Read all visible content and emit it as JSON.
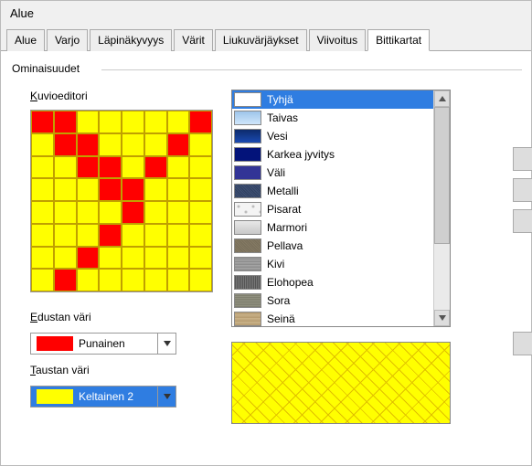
{
  "window": {
    "title": "Alue"
  },
  "tabs": [
    {
      "label": "Alue",
      "active": false
    },
    {
      "label": "Varjo",
      "active": false
    },
    {
      "label": "Läpinäkyvyys",
      "active": false
    },
    {
      "label": "Värit",
      "active": false
    },
    {
      "label": "Liukuvärjäykset",
      "active": false
    },
    {
      "label": "Viivoitus",
      "active": false
    },
    {
      "label": "Bittikartat",
      "active": true
    }
  ],
  "fieldset": {
    "label": "Ominaisuudet"
  },
  "editor": {
    "label": "Kuvioeditori",
    "label_underline_first": "K",
    "grid": [
      [
        "cr",
        "cr",
        "cy",
        "cy",
        "cy",
        "cy",
        "cy",
        "cr"
      ],
      [
        "cy",
        "cr",
        "cr",
        "cy",
        "cy",
        "cy",
        "cr",
        "cy"
      ],
      [
        "cy",
        "cy",
        "cr",
        "cr",
        "cy",
        "cr",
        "cy",
        "cy"
      ],
      [
        "cy",
        "cy",
        "cy",
        "cr",
        "cr",
        "cy",
        "cy",
        "cy"
      ],
      [
        "cy",
        "cy",
        "cy",
        "cy",
        "cr",
        "cy",
        "cy",
        "cy"
      ],
      [
        "cy",
        "cy",
        "cy",
        "cr",
        "cy",
        "cy",
        "cy",
        "cy"
      ],
      [
        "cy",
        "cy",
        "cr",
        "cy",
        "cy",
        "cy",
        "cy",
        "cy"
      ],
      [
        "cy",
        "cr",
        "cy",
        "cy",
        "cy",
        "cy",
        "cy",
        "cy"
      ]
    ]
  },
  "foreground": {
    "label_char": "E",
    "label_rest": "dustan väri",
    "value": "Punainen",
    "color": "#ff0000"
  },
  "background": {
    "label_char": "T",
    "label_rest": "austan väri",
    "value": "Keltainen 2",
    "color": "#ffff00"
  },
  "bitmaps": {
    "selected": "Tyhjä",
    "items": [
      {
        "label": "Tyhjä",
        "selected": true,
        "style": "background:#fff"
      },
      {
        "label": "Taivas",
        "selected": false,
        "style": "background:linear-gradient(#9ec5ea,#cfe6fb)"
      },
      {
        "label": "Vesi",
        "selected": false,
        "style": "background:linear-gradient(#0d2b6b,#1a4ab2)"
      },
      {
        "label": "Karkea jyvitys",
        "selected": false,
        "style": "background:#03137a"
      },
      {
        "label": "Väli",
        "selected": false,
        "style": "background:#323496"
      },
      {
        "label": "Metalli",
        "selected": false,
        "style": "background:repeating-linear-gradient(45deg,#2a3a5a,#46587c 2px)"
      },
      {
        "label": "Pisarat",
        "selected": false,
        "style": "background:radial-gradient(circle at 4px 4px,#bbb 1px,transparent 2px),radial-gradient(circle at 12px 10px,#bbb 1px,transparent 2px),#f4f4f4;background-size:16px 16px"
      },
      {
        "label": "Marmori",
        "selected": false,
        "style": "background:linear-gradient(#e8e8e8,#c8c8c8)"
      },
      {
        "label": "Pellava",
        "selected": false,
        "style": "background:repeating-linear-gradient(45deg,#736a56,#8a7f68 2px)"
      },
      {
        "label": "Kivi",
        "selected": false,
        "style": "background:repeating-linear-gradient(0deg,#888,#aaa 3px)"
      },
      {
        "label": "Elohopea",
        "selected": false,
        "style": "background:repeating-linear-gradient(90deg,#444,#888 2px)"
      },
      {
        "label": "Sora",
        "selected": false,
        "style": "background:repeating-linear-gradient(0deg,#776,#998 2px)"
      },
      {
        "label": "Seinä",
        "selected": false,
        "style": "background:repeating-linear-gradient(0deg,#b59a6e,#cbb48a 4px)"
      }
    ]
  }
}
